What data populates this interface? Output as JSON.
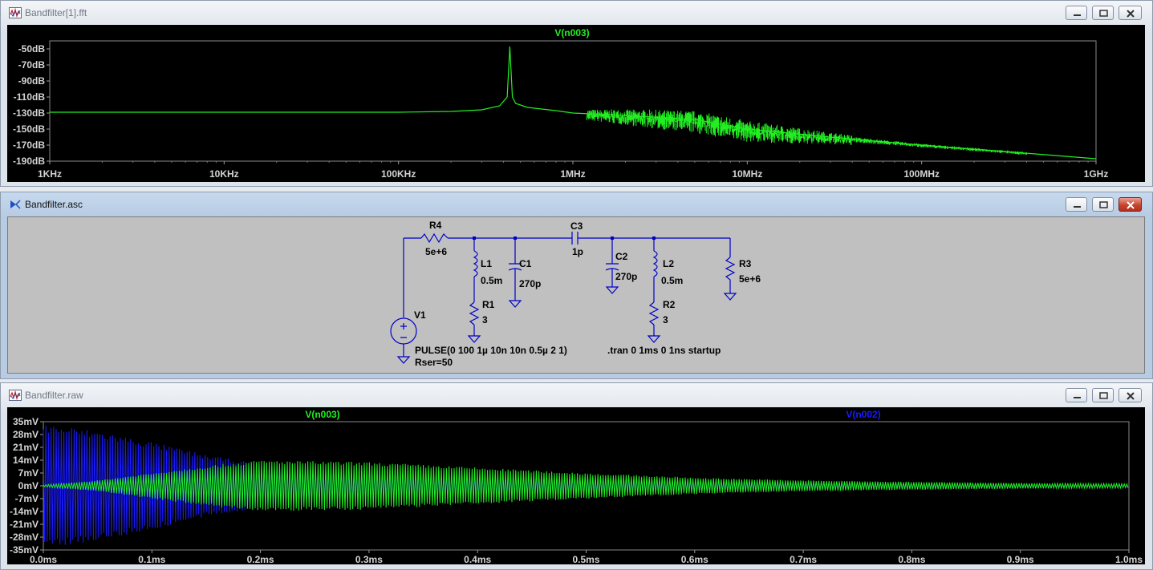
{
  "colors": {
    "trace_green": "#22ee22",
    "trace_blue": "#1a1aff",
    "schematic_wire": "#0000c8",
    "schematic_bg": "#c0c0c0",
    "plot_bg": "#000000"
  },
  "fft_window": {
    "title": "Bandfilter[1].fft",
    "icon": "waveform-icon",
    "trace_label": "V(n003)",
    "y_ticks": [
      "-50dB",
      "-70dB",
      "-90dB",
      "-110dB",
      "-130dB",
      "-150dB",
      "-170dB",
      "-190dB"
    ],
    "x_ticks": [
      "1KHz",
      "10KHz",
      "100KHz",
      "1MHz",
      "10MHz",
      "100MHz",
      "1GHz"
    ]
  },
  "schematic_window": {
    "title": "Bandfilter.asc",
    "icon": "schematic-icon",
    "components": {
      "r4_name": "R4",
      "r4_value": "5e+6",
      "c3_name": "C3",
      "c3_value": "1p",
      "l1_name": "L1",
      "l1_value": "0.5m",
      "c1_name": "C1",
      "c1_value": "270p",
      "r1_name": "R1",
      "r1_value": "3",
      "c2_name": "C2",
      "c2_value": "270p",
      "l2_name": "L2",
      "l2_value": "0.5m",
      "r2_name": "R2",
      "r2_value": "3",
      "r3_name": "R3",
      "r3_value": "5e+6",
      "v1_name": "V1",
      "v1_value": "PULSE(0 100 1µ 10n 10n 0.5µ 2 1)",
      "v1_rser": "Rser=50"
    },
    "directive": ".tran 0 1ms 0 1ns startup"
  },
  "raw_window": {
    "title": "Bandfilter.raw",
    "icon": "waveform-icon",
    "trace1_label": "V(n003)",
    "trace2_label": "V(n002)",
    "y_ticks": [
      "35mV",
      "28mV",
      "21mV",
      "14mV",
      "7mV",
      "0mV",
      "-7mV",
      "-14mV",
      "-21mV",
      "-28mV",
      "-35mV"
    ],
    "x_ticks": [
      "0.0ms",
      "0.1ms",
      "0.2ms",
      "0.3ms",
      "0.4ms",
      "0.5ms",
      "0.6ms",
      "0.7ms",
      "0.8ms",
      "0.9ms",
      "1.0ms"
    ]
  },
  "chart_data": [
    {
      "type": "line",
      "title": "V(n003)",
      "x_scale": "log",
      "xlim": [
        1000,
        1000000000
      ],
      "ylim": [
        -190,
        -40
      ],
      "ylabel_unit": "dB",
      "series": [
        {
          "name": "V(n003)",
          "x": [
            1000,
            10000,
            100000,
            200000,
            300000,
            380000,
            420000,
            435000,
            450000,
            470000,
            550000,
            800000,
            1000000,
            2000000,
            5000000,
            10000000,
            30000000,
            100000000,
            300000000,
            1000000000
          ],
          "y": [
            -129,
            -129,
            -129,
            -128,
            -126,
            -121,
            -110,
            -47,
            -110,
            -118,
            -123,
            -127,
            -130,
            -133,
            -138,
            -150,
            -160,
            -170,
            -178,
            -187
          ]
        }
      ]
    },
    {
      "type": "line",
      "xlabel_unit": "ms",
      "ylabel_unit": "mV",
      "xlim": [
        0,
        1.0
      ],
      "ylim": [
        -35,
        35
      ],
      "series": [
        {
          "name": "V(n003)",
          "envelope_x": [
            0,
            0.05,
            0.1,
            0.15,
            0.2,
            0.3,
            0.4,
            0.5,
            0.6,
            0.7,
            0.8,
            0.9,
            1.0
          ],
          "envelope_y": [
            0.5,
            3,
            7,
            11,
            14,
            13,
            10,
            7,
            4.5,
            3,
            2.2,
            1.6,
            1.2
          ]
        },
        {
          "name": "V(n002)",
          "envelope_x": [
            0,
            0.05,
            0.1,
            0.15,
            0.2,
            0.3,
            0.4,
            0.5,
            0.6,
            0.7,
            0.8,
            0.9,
            1.0
          ],
          "envelope_y": [
            34,
            30,
            24,
            17,
            12,
            7,
            5,
            3.5,
            2.5,
            1.5,
            1,
            0.6,
            0.4
          ]
        }
      ]
    }
  ]
}
